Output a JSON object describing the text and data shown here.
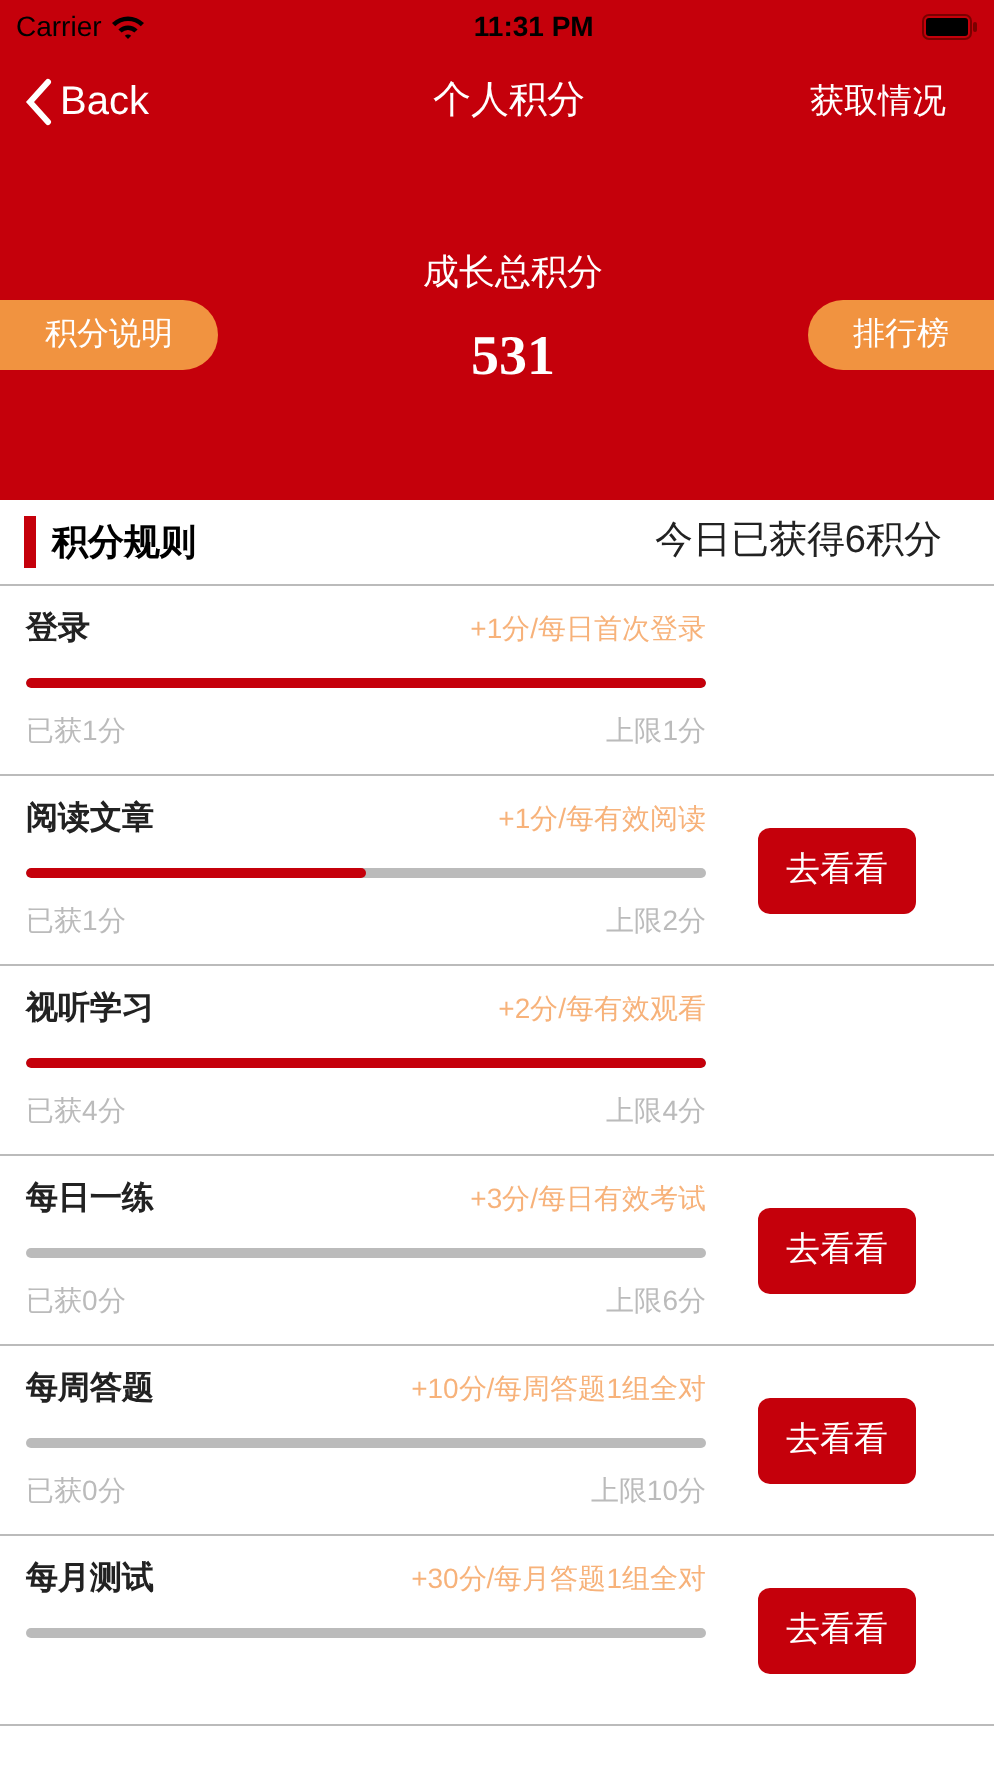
{
  "status_bar": {
    "carrier": "Carrier",
    "time": "11:31 PM"
  },
  "nav": {
    "back": "Back",
    "title": "个人积分",
    "action": "获取情况"
  },
  "header": {
    "label": "成长总积分",
    "total": "531",
    "left_button": "积分说明",
    "right_button": "排行榜"
  },
  "rules": {
    "title": "积分规则",
    "today": "今日已获得6积分"
  },
  "items": [
    {
      "name": "登录",
      "rule": "+1分/每日首次登录",
      "level": 1,
      "earned": "已获1分",
      "limit": "上限1分"
    },
    {
      "name": "阅读文章",
      "rule": "+1分/每有效阅读",
      "level": 0.5,
      "earned": "已获1分",
      "limit": "上限2分",
      "button": "去看看"
    },
    {
      "name": "视听学习",
      "rule": "+2分/每有效观看",
      "level": 1,
      "earned": "已获4分",
      "limit": "上限4分"
    },
    {
      "name": "每日一练",
      "rule": "+3分/每日有效考试",
      "level": 0,
      "earned": "已获0分",
      "limit": "上限6分",
      "button": "去看看"
    },
    {
      "name": "每周答题",
      "rule": "+10分/每周答题1组全对",
      "level": 0,
      "earned": "已获0分",
      "limit": "上限10分",
      "button": "去看看"
    },
    {
      "name": "每月测试",
      "rule": "+30分/每月答题1组全对",
      "level": 0,
      "button": "去看看"
    }
  ]
}
